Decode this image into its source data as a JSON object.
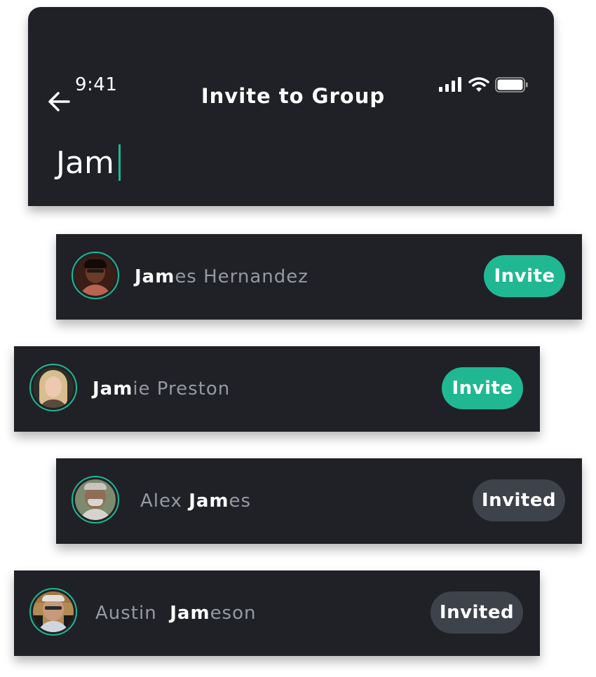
{
  "header": {
    "time": "9:41",
    "title": "Invite to Group",
    "search_value": "Jam"
  },
  "icons": {
    "back": "arrow-left-icon",
    "signal": "cellular-signal-icon",
    "wifi": "wifi-icon",
    "battery": "battery-icon"
  },
  "colors": {
    "accent": "#1fb892",
    "card_bg": "#1f2126",
    "invited_bg": "#3e424a",
    "muted_text": "#9599a2"
  },
  "contacts": [
    {
      "pre": "",
      "match": "Jam",
      "post": "es Hernandez",
      "action": "Invite"
    },
    {
      "pre": "",
      "match": "Jam",
      "post": "ie Preston",
      "action": "Invite"
    },
    {
      "pre": "Alex ",
      "match": "Jam",
      "post": "es",
      "action": "Invited"
    },
    {
      "pre": "Austin  ",
      "match": "Jam",
      "post": "eson",
      "action": "Invited"
    }
  ]
}
